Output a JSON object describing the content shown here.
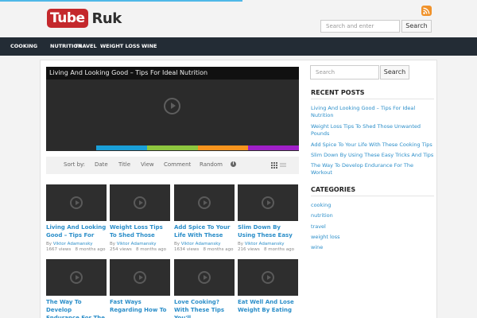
{
  "header": {
    "logo_part1": "Tube",
    "logo_part2": "Ruk",
    "rss_icon": "rss-icon",
    "search_placeholder": "Search and enter",
    "search_button": "Search"
  },
  "nav": {
    "items": [
      "COOKING",
      "NUTRITION",
      "TRAVEL",
      "WEIGHT LOSS",
      "WINE"
    ]
  },
  "player": {
    "title": "Living And Looking Good – Tips For Ideal Nutrition",
    "color_bar": [
      "#1a9fd8",
      "#8dc63f",
      "#f7941d",
      "#a020c8"
    ]
  },
  "sort": {
    "label": "Sort by:",
    "options": [
      "Date",
      "Title",
      "View",
      "Comment",
      "Random"
    ],
    "view_icons": [
      "info-icon",
      "grid-view-icon",
      "list-view-icon"
    ]
  },
  "videos": [
    {
      "title": "Living And Looking Good – Tips For Ideal Nutrition",
      "author": "Viktor Adamansky",
      "views": "1667 views",
      "age": "8 months ago"
    },
    {
      "title": "Weight Loss Tips To Shed Those Unwanted Pounds",
      "author": "Viktor Adamansky",
      "views": "254 views",
      "age": "8 months ago"
    },
    {
      "title": "Add Spice To Your Life With These Cooking Tips",
      "author": "Viktor Adamansky",
      "views": "1634 views",
      "age": "8 months ago"
    },
    {
      "title": "Slim Down By Using These Easy Tricks And Tips",
      "author": "Viktor Adamansky",
      "views": "216 views",
      "age": "8 months ago"
    },
    {
      "title": "The Way To Develop Endurance For The Workout",
      "author": "",
      "views": "",
      "age": ""
    },
    {
      "title": "Fast Ways Regarding How To",
      "author": "",
      "views": "",
      "age": ""
    },
    {
      "title": "Love Cooking? With These Tips You'll",
      "author": "",
      "views": "",
      "age": ""
    },
    {
      "title": "Eat Well And Lose Weight By Eating",
      "author": "",
      "views": "",
      "age": ""
    }
  ],
  "by_prefix": "By",
  "sidebar": {
    "search_placeholder": "Search",
    "search_button": "Search",
    "recent_heading": "RECENT POSTS",
    "recent_posts": [
      "Living And Looking Good – Tips For Ideal Nutrition",
      "Weight Loss Tips To Shed Those Unwanted Pounds",
      "Add Spice To Your Life With These Cooking Tips",
      "Slim Down By Using These Easy Tricks And Tips",
      "The Way To Develop Endurance For The Workout"
    ],
    "categories_heading": "CATEGORIES",
    "categories": [
      "cooking",
      "nutrition",
      "travel",
      "weight loss",
      "wine"
    ]
  }
}
